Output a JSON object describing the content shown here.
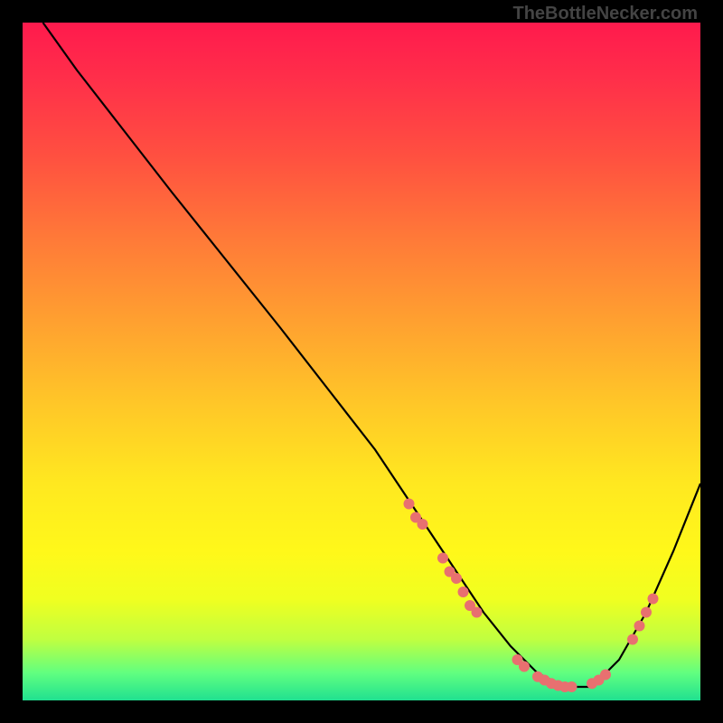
{
  "watermark": "TheBottleNecker.com",
  "chart_data": {
    "type": "line",
    "title": "",
    "xlabel": "",
    "ylabel": "",
    "xlim": [
      0,
      100
    ],
    "ylim": [
      0,
      100
    ],
    "series": [
      {
        "name": "curve",
        "x": [
          3,
          8,
          15,
          22,
          30,
          38,
          45,
          52,
          56,
          60,
          64,
          68,
          72,
          76,
          80,
          84,
          88,
          92,
          96,
          100
        ],
        "y": [
          100,
          93,
          84,
          75,
          65,
          55,
          46,
          37,
          31,
          25,
          19,
          13,
          8,
          4,
          2,
          2,
          6,
          13,
          22,
          32
        ]
      }
    ],
    "markers": [
      {
        "x": 57,
        "y": 29
      },
      {
        "x": 58,
        "y": 27
      },
      {
        "x": 59,
        "y": 26
      },
      {
        "x": 62,
        "y": 21
      },
      {
        "x": 63,
        "y": 19
      },
      {
        "x": 64,
        "y": 18
      },
      {
        "x": 65,
        "y": 16
      },
      {
        "x": 66,
        "y": 14
      },
      {
        "x": 67,
        "y": 13
      },
      {
        "x": 73,
        "y": 6
      },
      {
        "x": 74,
        "y": 5
      },
      {
        "x": 76,
        "y": 3.5
      },
      {
        "x": 77,
        "y": 3
      },
      {
        "x": 78,
        "y": 2.5
      },
      {
        "x": 79,
        "y": 2.2
      },
      {
        "x": 80,
        "y": 2
      },
      {
        "x": 81,
        "y": 2
      },
      {
        "x": 84,
        "y": 2.5
      },
      {
        "x": 85,
        "y": 3
      },
      {
        "x": 86,
        "y": 3.8
      },
      {
        "x": 90,
        "y": 9
      },
      {
        "x": 91,
        "y": 11
      },
      {
        "x": 92,
        "y": 13
      },
      {
        "x": 93,
        "y": 15
      }
    ]
  }
}
